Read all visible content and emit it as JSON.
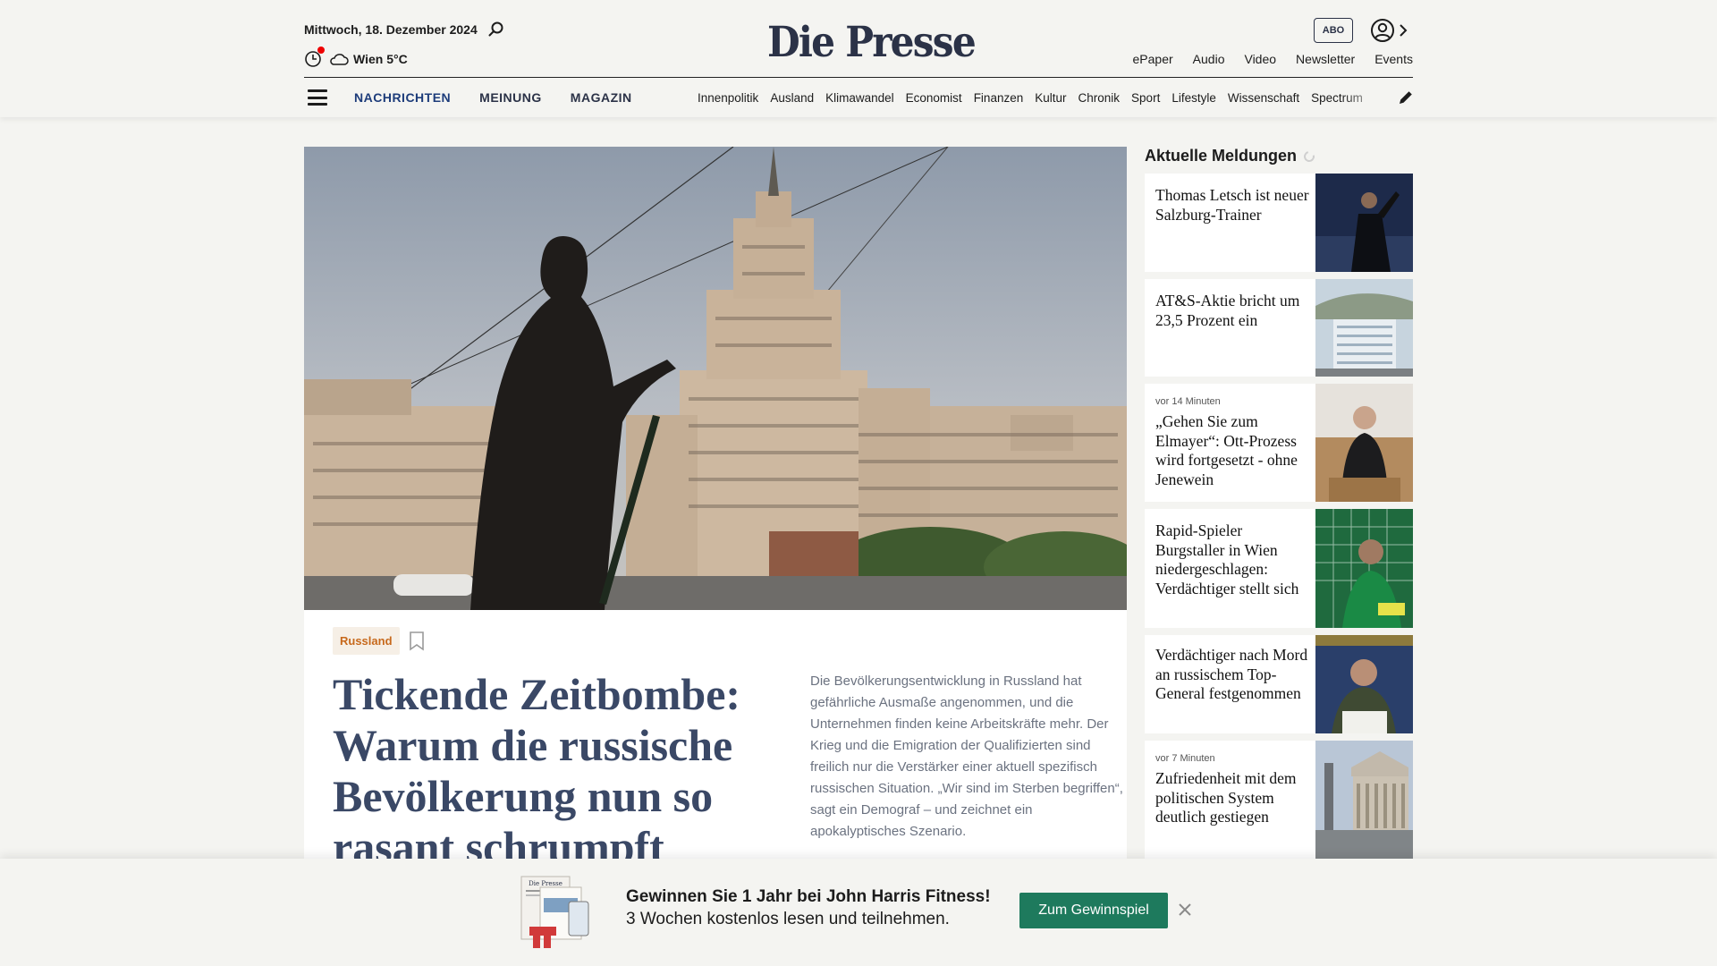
{
  "header": {
    "date": "Mittwoch, 18. Dezember 2024",
    "weather": "Wien 5°C",
    "logo": "Die Presse",
    "abo": "ABO",
    "links": [
      "ePaper",
      "Audio",
      "Video",
      "Newsletter",
      "Events"
    ]
  },
  "nav": {
    "main": [
      "NACHRICHTEN",
      "MEINUNG",
      "MAGAZIN"
    ],
    "sub": [
      "Innenpolitik",
      "Ausland",
      "Klimawandel",
      "Economist",
      "Finanzen",
      "Kultur",
      "Chronik",
      "Sport",
      "Lifestyle",
      "Wissenschaft",
      "Spectrum"
    ]
  },
  "lead": {
    "tag": "Russland",
    "headline": "Tickende Zeitbombe: Warum die russische Bevölkerung nun so rasant schrumpft",
    "teaser": "Die Bevölkerungsentwicklung in Russland hat gefährliche Ausmaße angenommen, und die Unternehmen finden keine Arbeitskräfte mehr. Der Krieg und die Emigration der Qualifizierten sind freilich nur die Verstärker einer aktuell spezifisch russischen Situation. „Wir sind im Sterben begriffen“, sagt ein Demograf – und zeichnet ein apokalyptisches Szenario."
  },
  "sidebar": {
    "title": "Aktuelle Meldungen",
    "items": [
      {
        "time": "",
        "title": "Thomas Letsch ist neuer Salzburg-Trainer"
      },
      {
        "time": "",
        "title": "AT&S-Aktie bricht um 23,5 Prozent ein"
      },
      {
        "time": "vor 14 Minuten",
        "title": "„Gehen Sie zum Elmayer“: Ott-Prozess wird fortgesetzt - ohne Jenewein"
      },
      {
        "time": "",
        "title": "Rapid-Spieler Burgstaller in Wien niedergeschlagen: Verdächtiger stellt sich"
      },
      {
        "time": "",
        "title": "Verdächtiger nach Mord an russischem Top-General festgenommen"
      },
      {
        "time": "vor 7 Minuten",
        "title": "Zufriedenheit mit dem politischen System deutlich gestiegen"
      }
    ]
  },
  "promo": {
    "line1": "Gewinnen Sie 1 Jahr bei John Harris Fitness!",
    "line2": "3 Wochen kostenlos lesen und teilnehmen.",
    "button": "Zum Gewinnspiel",
    "image_text": "Die Presse"
  },
  "colors": {
    "brand": "#2b3247",
    "accent_tag": "#c7691c",
    "promo_button": "#1e7a5d",
    "background": "#f4f4f1"
  }
}
